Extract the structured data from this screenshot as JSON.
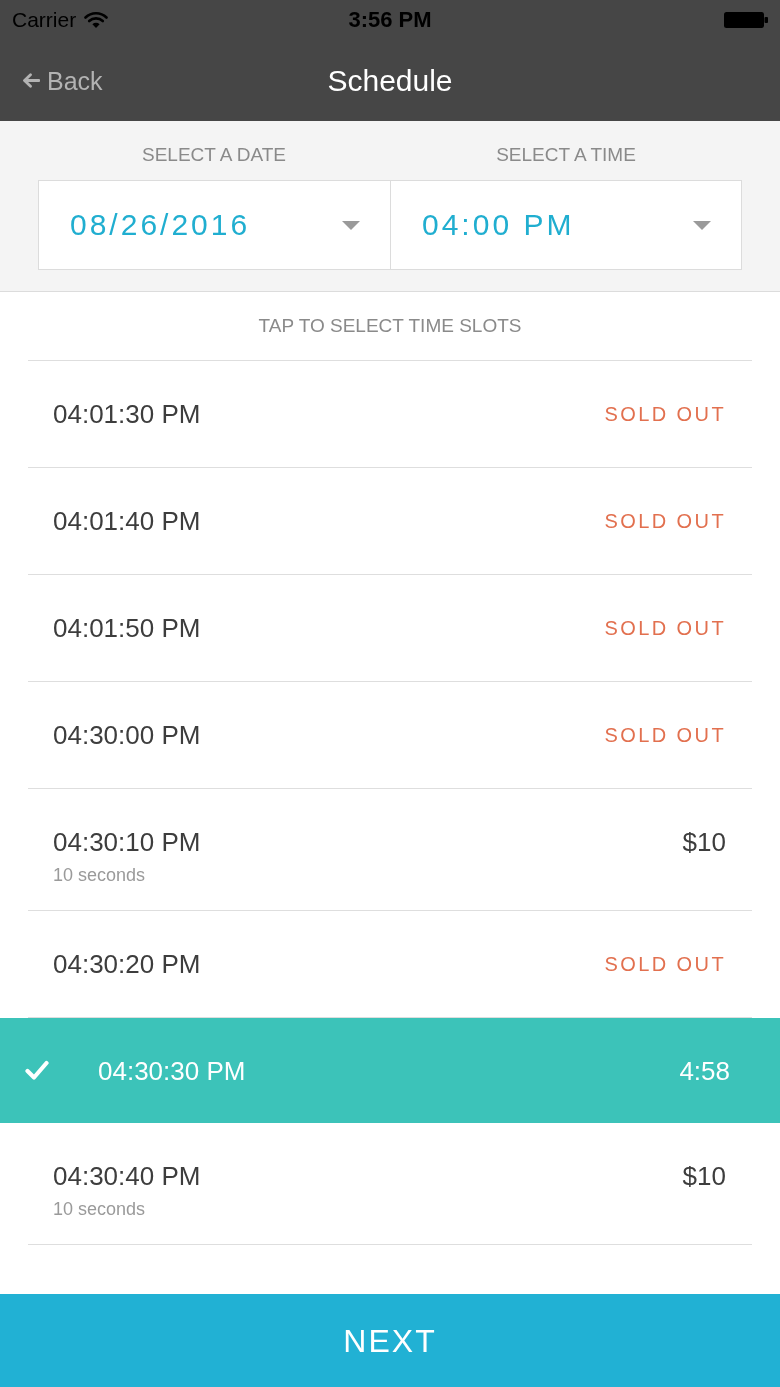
{
  "status_bar": {
    "carrier": "Carrier",
    "time": "3:56 PM"
  },
  "nav": {
    "back": "Back",
    "title": "Schedule"
  },
  "pickers": [
    {
      "label": "SELECT A DATE",
      "value": "08/26/2016"
    },
    {
      "label": "SELECT A TIME",
      "value": "04:00 PM"
    }
  ],
  "list": {
    "heading": "TAP TO SELECT TIME SLOTS",
    "slots": [
      {
        "time": "04:01:30 PM",
        "kind": "sold_out",
        "info": "SOLD OUT",
        "selected": false
      },
      {
        "time": "04:01:40 PM",
        "kind": "sold_out",
        "info": "SOLD OUT",
        "selected": false
      },
      {
        "time": "04:01:50 PM",
        "kind": "sold_out",
        "info": "SOLD OUT",
        "selected": false
      },
      {
        "time": "04:30:00 PM",
        "kind": "sold_out",
        "info": "SOLD OUT",
        "selected": false
      },
      {
        "time": "04:30:10 PM",
        "note": "10 seconds",
        "kind": "price",
        "info": "$10",
        "selected": false
      },
      {
        "time": "04:30:20 PM",
        "kind": "sold_out",
        "info": "SOLD OUT",
        "selected": false
      },
      {
        "time": "04:30:30 PM",
        "kind": "timer",
        "info": "4:58",
        "selected": true
      },
      {
        "time": "04:30:40 PM",
        "note": "10 seconds",
        "kind": "price",
        "info": "$10",
        "selected": false
      }
    ]
  },
  "next_button": "NEXT"
}
